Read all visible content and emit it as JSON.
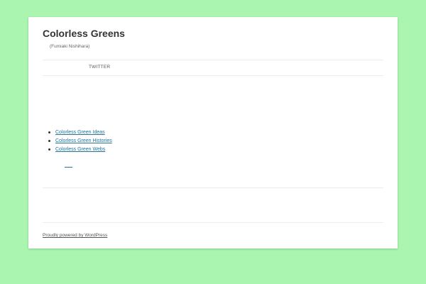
{
  "colors": {
    "background": "#aaf5af",
    "page": "#ffffff",
    "link": "#21759b"
  },
  "header": {
    "site_title": "Colorless Greens",
    "site_description": "(Fumiaki Nishihara)"
  },
  "nav": {
    "items": [
      {
        "label": "TWITTER"
      }
    ]
  },
  "links": [
    {
      "label": "Colorless Green Ideas"
    },
    {
      "label": "Colorless Green Histories"
    },
    {
      "label": "Colorless Green Webs"
    }
  ],
  "footer": {
    "credit": "Proudly powered by WordPress"
  }
}
